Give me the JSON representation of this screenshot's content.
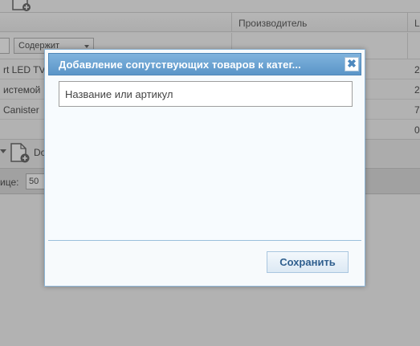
{
  "background": {
    "grid": {
      "columns": [
        {
          "title": "Производитель"
        },
        {
          "title": "L"
        }
      ],
      "filter_select": "Содержит",
      "rows": [
        {
          "name": "rt LED TV",
          "value": "2"
        },
        {
          "name": "истемой",
          "value": "2"
        },
        {
          "name": "Canister",
          "value": "7"
        },
        {
          "name": "",
          "value": "0"
        }
      ]
    },
    "bottom_toolbar": {
      "add_label": "Do"
    },
    "pager": {
      "label": "ице:",
      "page_size": "50"
    }
  },
  "dialog": {
    "title": "Добавление сопутствующих товаров к катег...",
    "close_symbol": "✖",
    "search": {
      "placeholder": "Название или артикул",
      "value": ""
    },
    "save_label": "Сохранить"
  },
  "colors": {
    "header_gradient_top": "#7fb3dd",
    "header_gradient_bottom": "#5b95c8",
    "save_text": "#2f5f8e",
    "overlay": "rgba(70,70,70,0.38)"
  }
}
